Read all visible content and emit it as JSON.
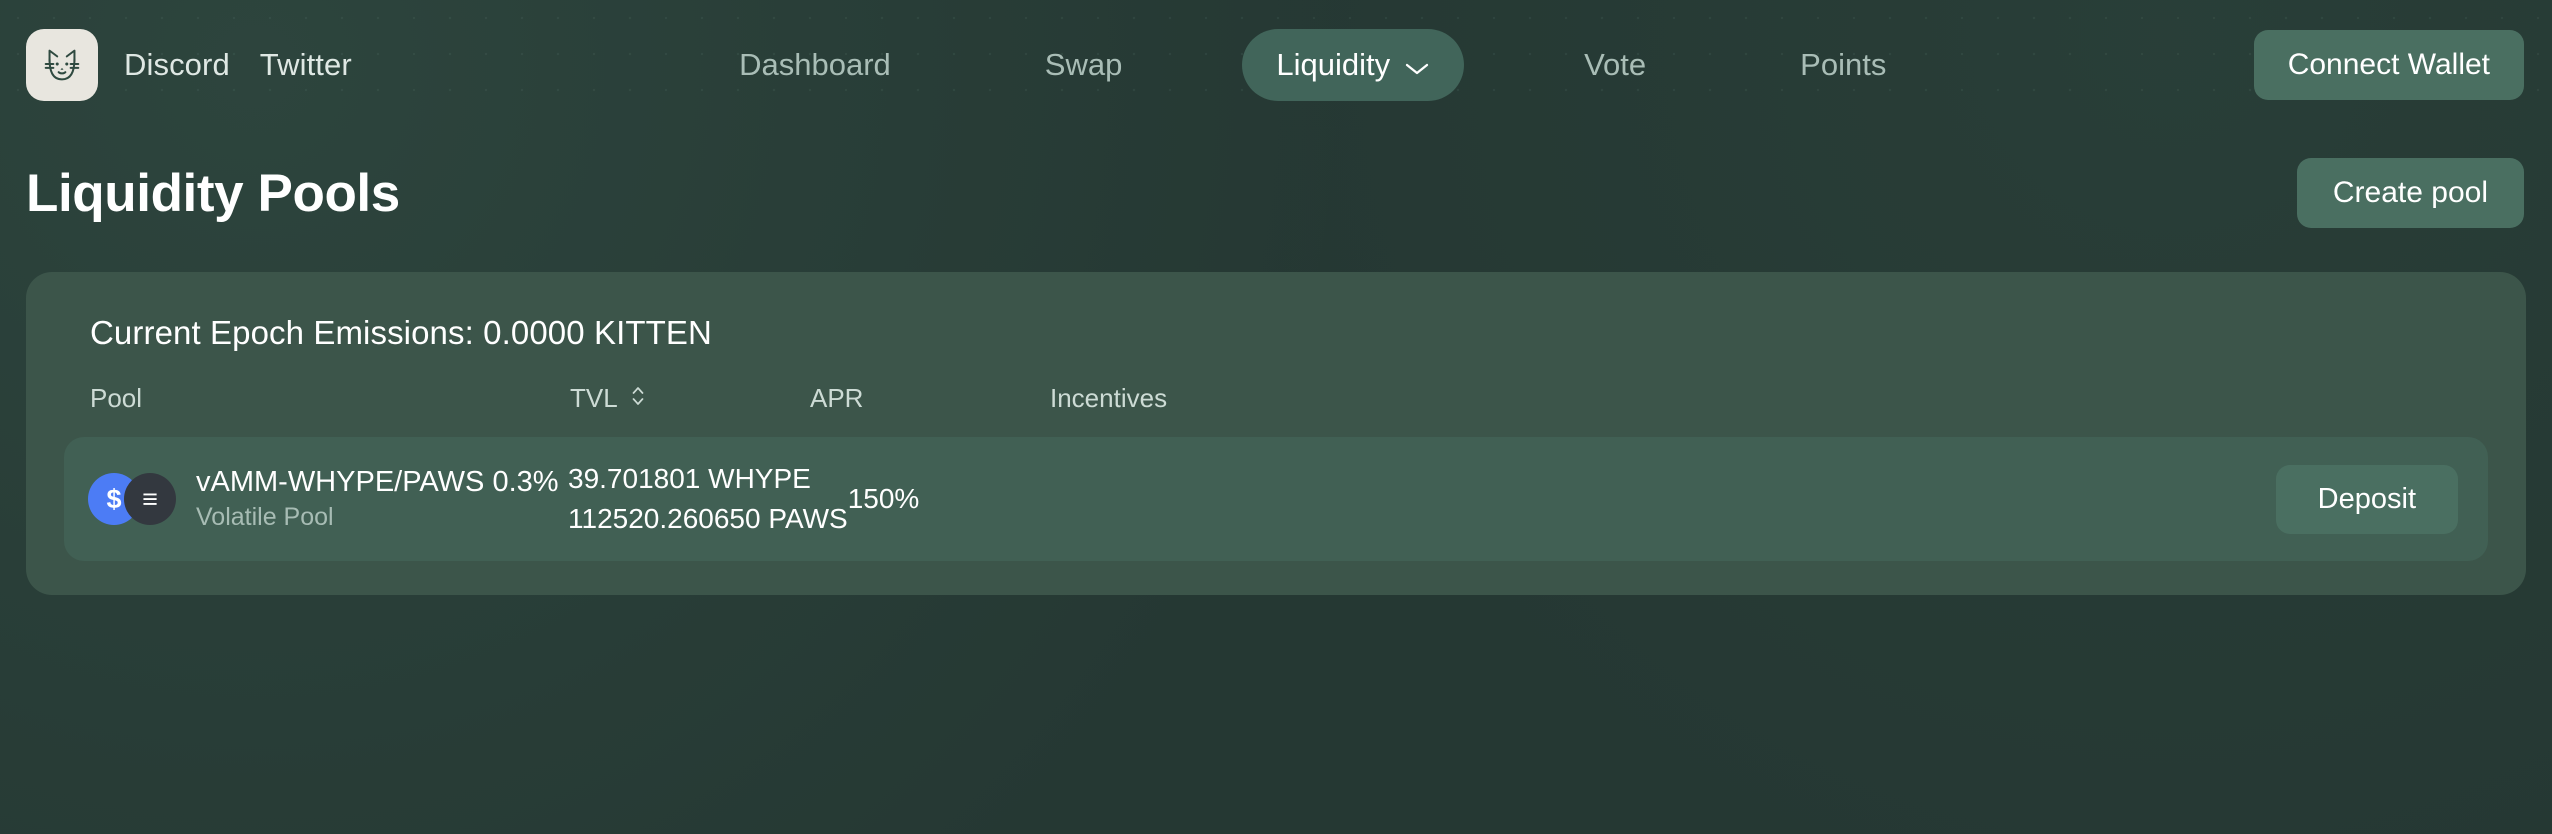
{
  "header": {
    "logo_icon": "cat-face-icon",
    "social_links": [
      {
        "label": "Discord"
      },
      {
        "label": "Twitter"
      }
    ],
    "nav_items": [
      {
        "label": "Dashboard",
        "active": false,
        "has_chevron": false
      },
      {
        "label": "Swap",
        "active": false,
        "has_chevron": false
      },
      {
        "label": "Liquidity",
        "active": true,
        "has_chevron": true
      },
      {
        "label": "Vote",
        "active": false,
        "has_chevron": false
      },
      {
        "label": "Points",
        "active": false,
        "has_chevron": false
      }
    ],
    "connect_wallet_label": "Connect Wallet"
  },
  "page": {
    "title": "Liquidity Pools",
    "create_pool_label": "Create pool"
  },
  "pools_card": {
    "epoch_emissions": "Current Epoch Emissions: 0.0000 KITTEN",
    "columns": {
      "pool": "Pool",
      "tvl": "TVL",
      "tvl_sort_icon": "sort-updown-icon",
      "apr": "APR",
      "incentives": "Incentives"
    },
    "rows": [
      {
        "token_a": {
          "symbol": "$",
          "icon": "dollar-token-icon",
          "color": "#4c7cf5"
        },
        "token_b": {
          "symbol": "≡",
          "icon": "bars-token-icon",
          "color": "#33383f"
        },
        "name": "vAMM-WHYPE/PAWS 0.3%",
        "type": "Volatile Pool",
        "tvl_line_1": "39.701801 WHYPE",
        "tvl_line_2": "112520.260650 PAWS",
        "apr": "150%",
        "incentives": "",
        "action_label": "Deposit"
      }
    ]
  },
  "colors": {
    "page_bg": "#253833",
    "card_bg": "#3c554a",
    "row_bg": "#416054",
    "accent_button": "#4a6f61",
    "active_pill": "#41655a",
    "muted_text": "#a9bdb6"
  }
}
